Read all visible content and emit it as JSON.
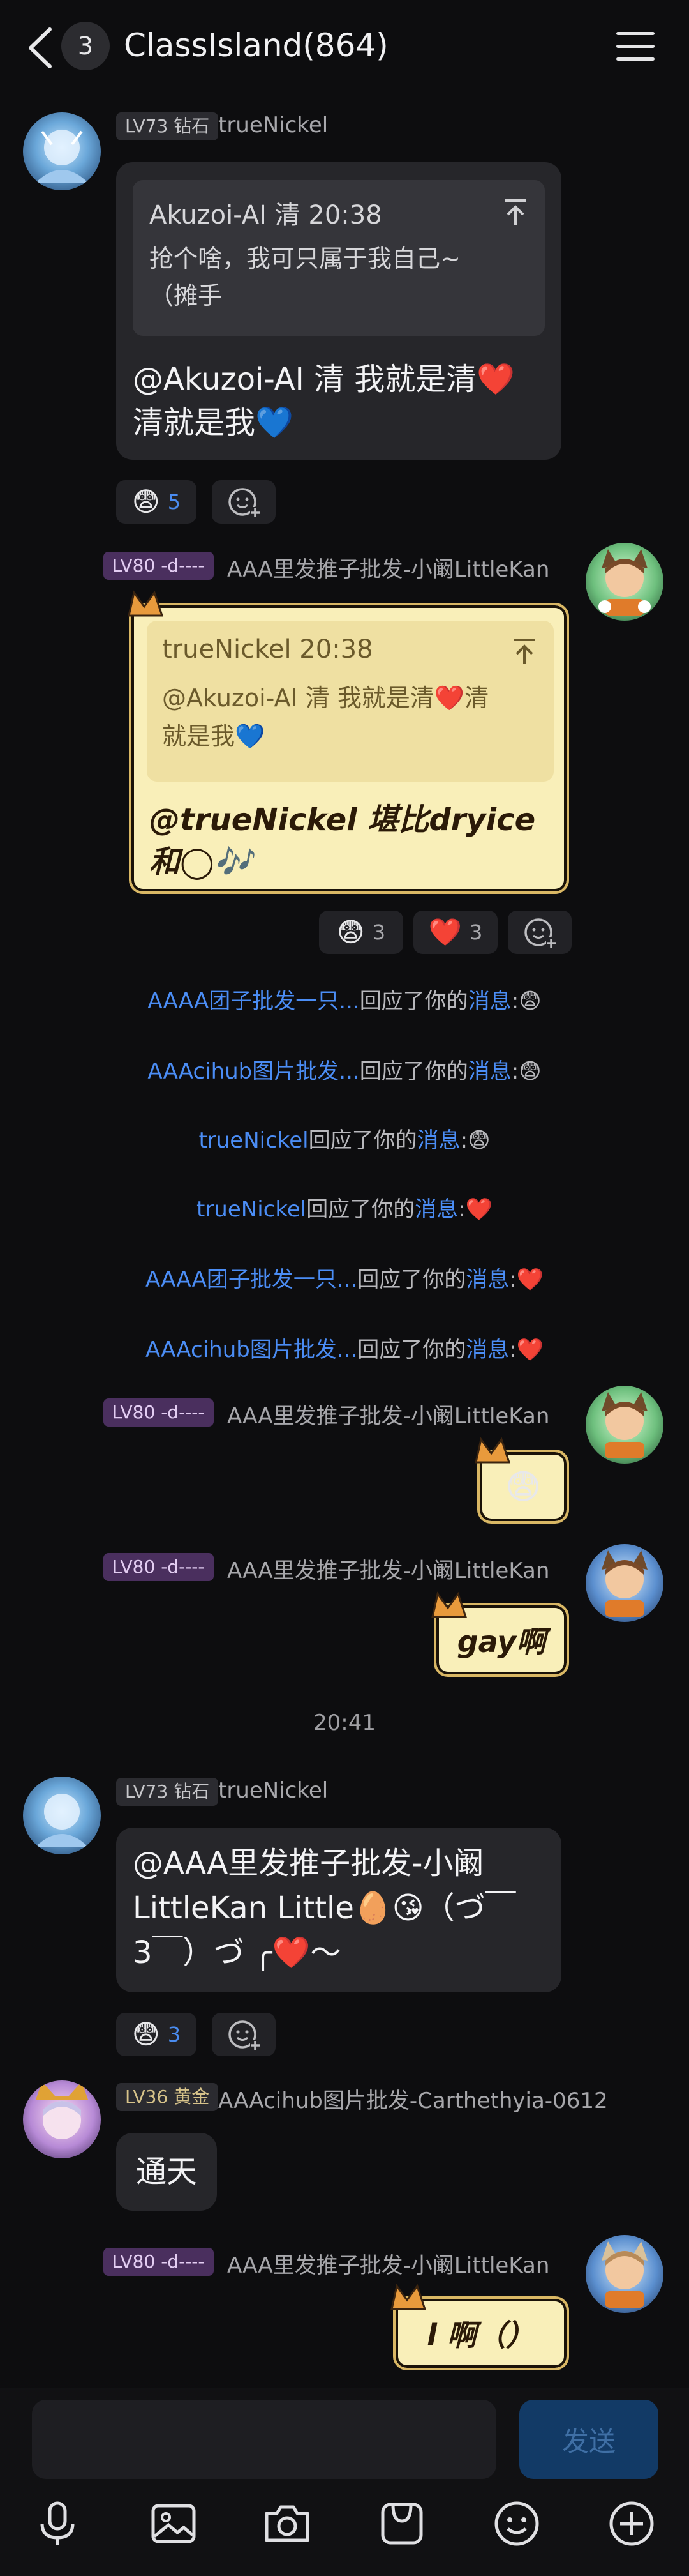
{
  "header": {
    "unread_count": "3",
    "title": "ClassIsland(864)"
  },
  "messages": {
    "m1": {
      "level": "LV73 钻石",
      "username": "trueNickel",
      "quote_head": "Akuzoi-AI 清 20:38",
      "quote_body_1": "抢个啥，我可只属于我自己~",
      "quote_body_2": "（摊手",
      "text_line1": "@Akuzoi-AI 清 我就是清❤️",
      "text_line2": "清就是我💙",
      "reaction_emoji": "😨",
      "reaction_count": "5"
    },
    "m2": {
      "level": "LV80 -d----",
      "username": "AAA里发推子批发-小阚LittleKan",
      "quote_head": "trueNickel 20:38",
      "quote_body_1": "@Akuzoi-AI 清 我就是清❤️清",
      "quote_body_2": "就是我💙",
      "text_line1": "@trueNickel 堪比dryice",
      "text_line2": "和◯🎶",
      "reaction1_emoji": "😨",
      "reaction1_count": "3",
      "reaction2_emoji": "❤️",
      "reaction2_count": "3"
    },
    "m3": {
      "level": "LV80 -d----",
      "username": "AAA里发推子批发-小阚LittleKan",
      "text": "😨"
    },
    "m4": {
      "level": "LV80 -d----",
      "username": "AAA里发推子批发-小阚LittleKan",
      "text": "gay啊"
    },
    "time_divider": "20:41",
    "m5": {
      "level": "LV73 钻石",
      "username": "trueNickel",
      "text_line1": "@AAA里发推子批发-小阚",
      "text_line2": "LittleKan Little🥚😘（づ￣",
      "text_line3": "3￣）づ ╭❤️～",
      "reaction_emoji": "😨",
      "reaction_count": "3"
    },
    "m6": {
      "level": "LV36 黄金",
      "username": "AAAcihub图片批发-Carthethyia-0612",
      "text": "通天"
    },
    "m7": {
      "level": "LV80 -d----",
      "username": "AAA里发推子批发-小阚LittleKan",
      "text": "l 啊（）"
    }
  },
  "notices": [
    {
      "name": "AAAA团子批发一只...",
      "mid": "回应了你的",
      "link": "消息",
      "emoji": ":😨"
    },
    {
      "name": "AAAcihub图片批发...",
      "mid": "回应了你的",
      "link": "消息",
      "emoji": ":😨"
    },
    {
      "name": "trueNickel",
      "mid": "回应了你的",
      "link": "消息",
      "emoji": ":😨"
    },
    {
      "name": "trueNickel",
      "mid": "回应了你的",
      "link": "消息",
      "emoji": ":❤️"
    },
    {
      "name": "AAAA团子批发一只...",
      "mid": "回应了你的",
      "link": "消息",
      "emoji": ":❤️"
    },
    {
      "name": "AAAcihub图片批发...",
      "mid": "回应了你的",
      "link": "消息",
      "emoji": ":❤️"
    }
  ],
  "input": {
    "send_label": "发送"
  },
  "toolbar_icons": [
    "mic-icon",
    "image-icon",
    "camera-icon",
    "sticker-icon",
    "emoji-icon",
    "plus-icon"
  ],
  "colors": {
    "background": "#0d0d0f",
    "bubble": "#26262a",
    "link_blue": "#4b8df5",
    "parchment": "#f9efb9",
    "level_purple": "#4a2f5e"
  }
}
